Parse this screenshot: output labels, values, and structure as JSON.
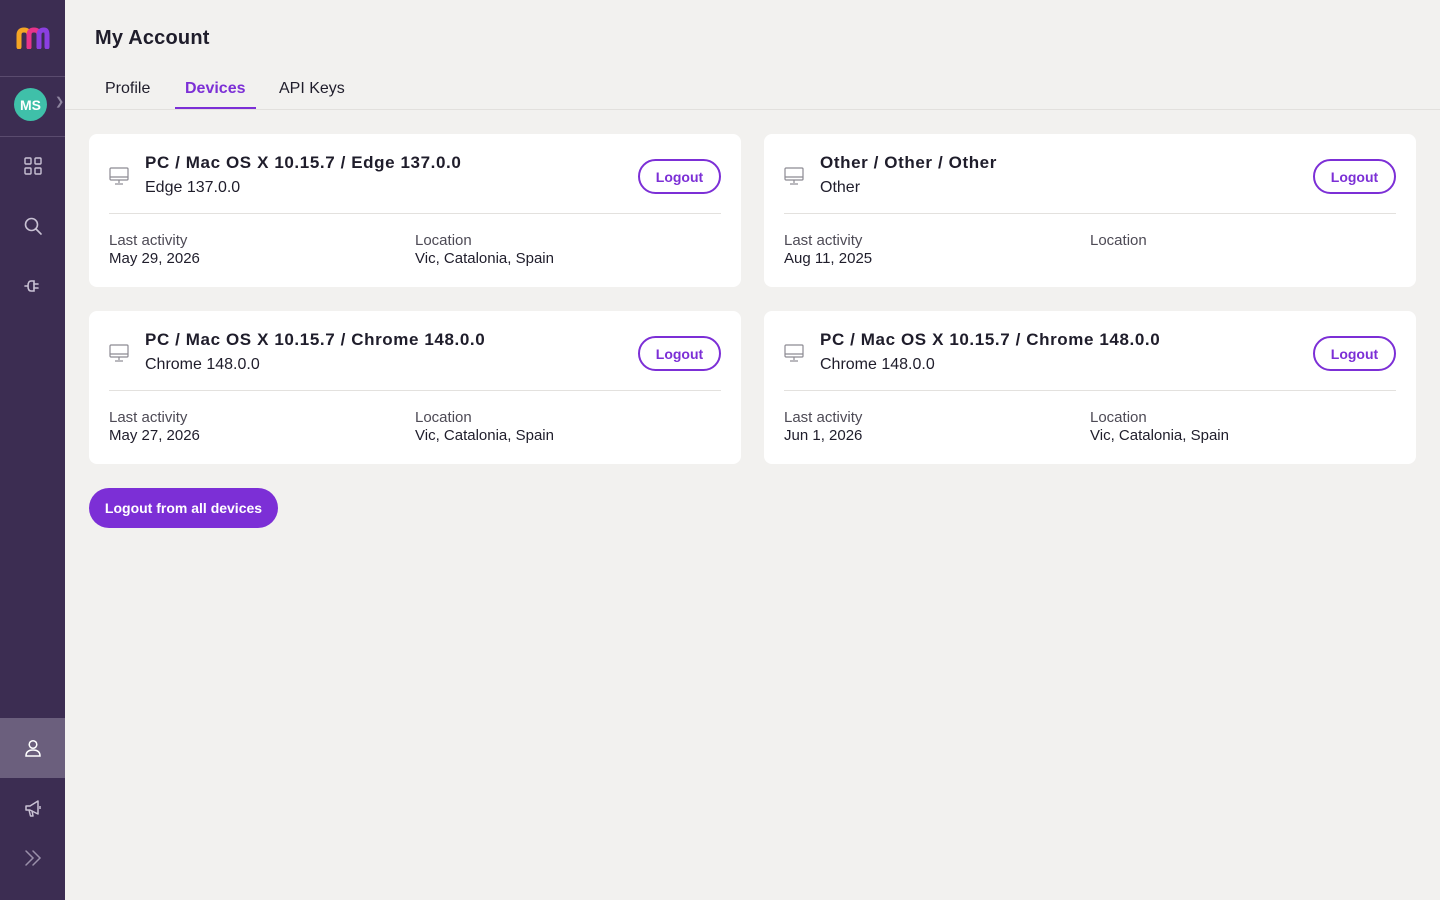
{
  "app": {
    "logo_icon": "brand-m-logo-icon",
    "colors": {
      "sidebar": "#3c2d52",
      "accent": "#7c2fd6",
      "avatar": "#3fc0a9",
      "background": "#f2f1ef"
    }
  },
  "sidebar": {
    "user_initials": "MS",
    "items": [
      {
        "icon": "grid-icon",
        "active": false
      },
      {
        "icon": "search-icon",
        "active": false
      },
      {
        "icon": "plug-icon",
        "active": false
      },
      {
        "icon": "user-icon",
        "active": true
      },
      {
        "icon": "megaphone-icon",
        "active": false
      },
      {
        "icon": "expand-chevrons-icon",
        "active": false
      }
    ]
  },
  "header": {
    "title": "My Account",
    "tabs": [
      {
        "label": "Profile",
        "active": false
      },
      {
        "label": "Devices",
        "active": true
      },
      {
        "label": "API Keys",
        "active": false
      }
    ]
  },
  "labels": {
    "last_activity": "Last activity",
    "location": "Location",
    "logout": "Logout",
    "logout_all": "Logout from all devices"
  },
  "devices": [
    {
      "name": "PC / Mac OS X 10.15.7 / Edge 137.0.0",
      "browser": "Edge 137.0.0",
      "last_activity": "May 29, 2026",
      "location": "Vic, Catalonia, Spain"
    },
    {
      "name": "Other / Other / Other",
      "browser": "Other",
      "last_activity": "Aug 11, 2025",
      "location": ""
    },
    {
      "name": "PC / Mac OS X 10.15.7 / Chrome 148.0.0",
      "browser": "Chrome 148.0.0",
      "last_activity": "May 27, 2026",
      "location": "Vic, Catalonia, Spain"
    },
    {
      "name": "PC / Mac OS X 10.15.7 / Chrome 148.0.0",
      "browser": "Chrome 148.0.0",
      "last_activity": "Jun 1, 2026",
      "location": "Vic, Catalonia, Spain"
    }
  ]
}
